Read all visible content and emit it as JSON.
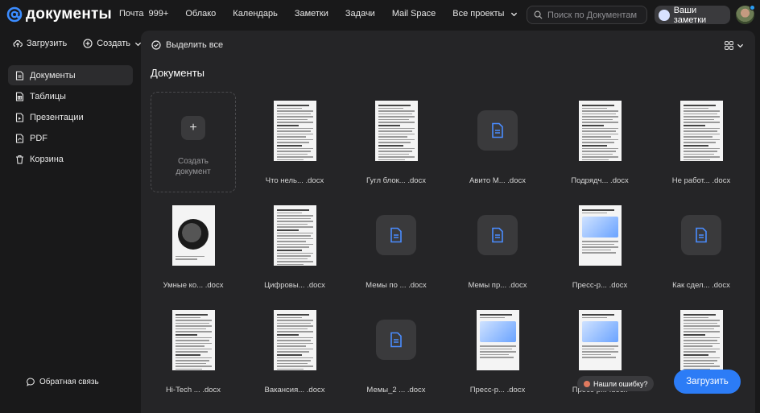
{
  "brand": {
    "logo_text": "документы"
  },
  "nav": {
    "items": [
      "Почта",
      "Облако",
      "Календарь",
      "Заметки",
      "Задачи",
      "Mail Space",
      "Все проекты"
    ],
    "mail_count": "999+"
  },
  "search": {
    "placeholder": "Поиск по Документам"
  },
  "notes_button": {
    "label": "Ваши заметки"
  },
  "sidebar": {
    "upload_label": "Загрузить",
    "create_label": "Создать",
    "items": [
      {
        "label": "Документы",
        "icon": "doc-icon"
      },
      {
        "label": "Таблицы",
        "icon": "table-icon"
      },
      {
        "label": "Презентации",
        "icon": "presentation-icon"
      },
      {
        "label": "PDF",
        "icon": "pdf-icon"
      },
      {
        "label": "Корзина",
        "icon": "trash-icon"
      }
    ],
    "feedback_label": "Обратная связь"
  },
  "toolbar": {
    "select_all_label": "Выделить все"
  },
  "main": {
    "title": "Документы",
    "create_tile": {
      "line1": "Создать",
      "line2": "документ"
    },
    "files": [
      {
        "name": "Что нель... .docx",
        "thumb": "page"
      },
      {
        "name": "Гугл блок... .docx",
        "thumb": "page"
      },
      {
        "name": "Авито М... .docx",
        "thumb": "placeholder"
      },
      {
        "name": "Подрядч... .docx",
        "thumb": "page"
      },
      {
        "name": "Не работ... .docx",
        "thumb": "page"
      },
      {
        "name": "Умные ко... .docx",
        "thumb": "product"
      },
      {
        "name": "Цифровы... .docx",
        "thumb": "page"
      },
      {
        "name": "Мемы по ... .docx",
        "thumb": "placeholder"
      },
      {
        "name": "Мемы пр... .docx",
        "thumb": "placeholder"
      },
      {
        "name": "Пресс-р... .docx",
        "thumb": "graphic"
      },
      {
        "name": "Как сдел... .docx",
        "thumb": "placeholder"
      },
      {
        "name": "Hi-Tech ... .docx",
        "thumb": "page"
      },
      {
        "name": "Вакансия... .docx",
        "thumb": "page"
      },
      {
        "name": "Мемы_2 ... .docx",
        "thumb": "placeholder"
      },
      {
        "name": "Пресс-р... .docx",
        "thumb": "graphic"
      },
      {
        "name": "Пресс-р... .docx",
        "thumb": "graphic"
      },
      {
        "name": "",
        "thumb": "page"
      }
    ]
  },
  "found_bug": {
    "label": "Нашли ошибку?"
  },
  "upload_fab": {
    "label": "Загрузить"
  },
  "colors": {
    "accent": "#2c7cf6",
    "background": "#19191a",
    "panel": "#252527"
  }
}
